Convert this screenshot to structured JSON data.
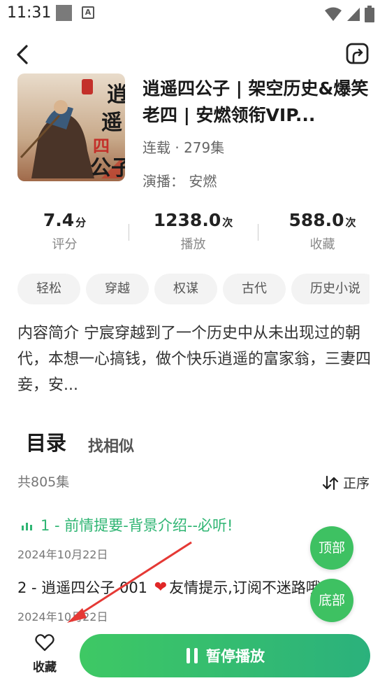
{
  "status_bar": {
    "time": "11:31"
  },
  "album": {
    "title": "逍遥四公子 | 架空历史&爆笑老四 | 安燃领衔VIP...",
    "status": "连载 · 279集",
    "narrator": "演播：  安燃",
    "cover_text": "逍遥四公子"
  },
  "stats": [
    {
      "value": "7.4",
      "unit": "分",
      "label": "评分"
    },
    {
      "value": "1238.0",
      "unit": "次",
      "label": "播放"
    },
    {
      "value": "588.0",
      "unit": "次",
      "label": "收藏"
    }
  ],
  "tags": [
    "轻松",
    "穿越",
    "权谋",
    "古代",
    "历史小说"
  ],
  "intro": "内容简介 宁宸穿越到了一个历史中从未出现过的朝代，本想一心搞钱，做个快乐逍遥的富家翁，三妻四妾，安...",
  "section": {
    "catalog_tab": "目录",
    "similar_tab": "找相似"
  },
  "episode_count": "共805集",
  "sort_label": "正序",
  "episodes": [
    {
      "title": "1 - 前情提要-背景介绍--必听!",
      "date": "2024年10月22日"
    },
    {
      "title_part1": "2 - 逍遥四公子 001 ",
      "title_part2": "友情提示,订阅不迷路哦!",
      "date": "2024年10月22日"
    }
  ],
  "float_buttons": {
    "top": "顶部",
    "bottom": "底部"
  },
  "bottom_bar": {
    "favorite_label": "收藏",
    "play_label": "暂停播放"
  },
  "colors": {
    "accent": "#2fb573",
    "annotation_arrow": "#e53935"
  }
}
